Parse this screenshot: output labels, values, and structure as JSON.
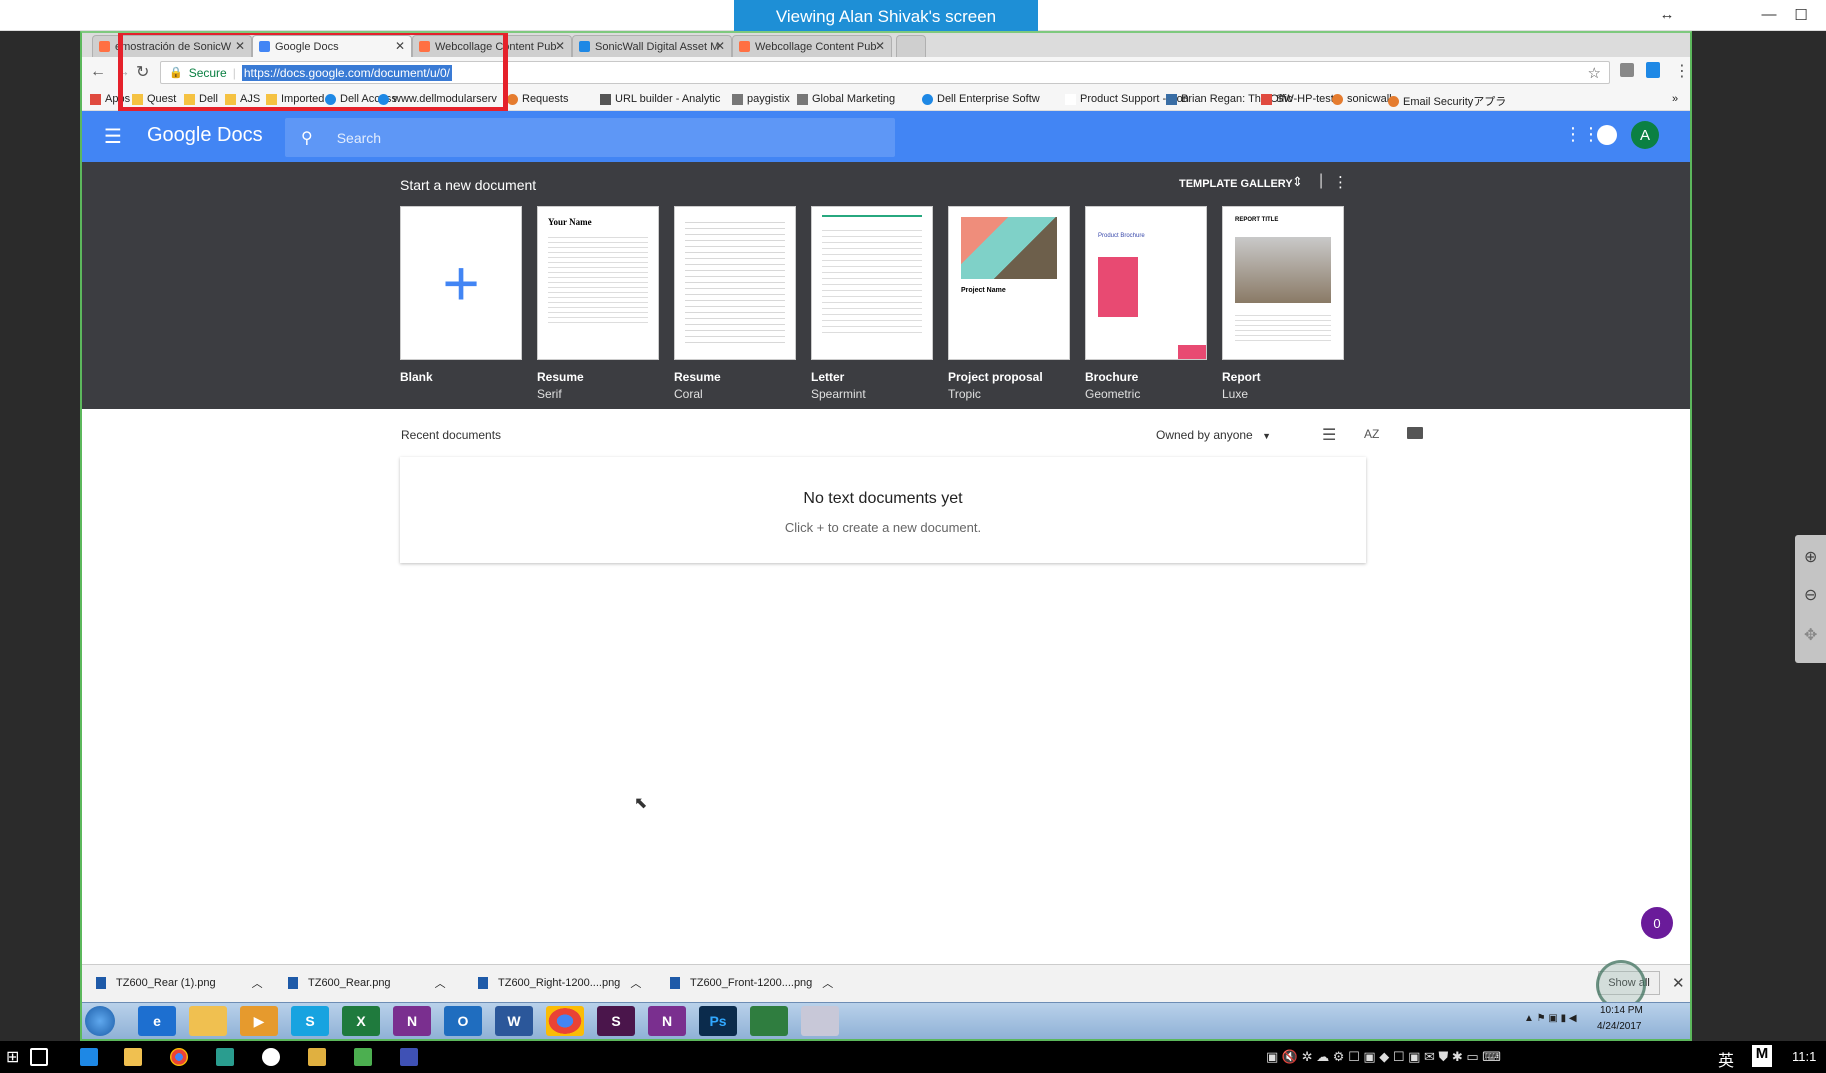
{
  "viewer": {
    "banner": "Viewing Alan Shivak's screen"
  },
  "browser": {
    "tabs": [
      {
        "label": "emostración de SonicW",
        "color": "#ff7043"
      },
      {
        "label": "Google Docs",
        "color": "#4285f4"
      },
      {
        "label": "Webcollage Content Pub",
        "color": "#ff7043"
      },
      {
        "label": "SonicWall Digital Asset M",
        "color": "#1e88e5"
      },
      {
        "label": "Webcollage Content Pub",
        "color": "#ff7043"
      }
    ],
    "secure_label": "Secure",
    "url": "https://docs.google.com/document/u/0/",
    "bookmarks": [
      {
        "label": "Apps",
        "icon": "apps-grid-icon",
        "color": "#e04a3f"
      },
      {
        "label": "Quest",
        "icon": "folder-icon",
        "color": "#f5c242"
      },
      {
        "label": "Dell",
        "icon": "folder-icon",
        "color": "#f5c242"
      },
      {
        "label": "AJS",
        "icon": "folder-icon",
        "color": "#f5c242"
      },
      {
        "label": "Imported",
        "icon": "folder-icon",
        "color": "#f5c242"
      },
      {
        "label": "Dell Access",
        "icon": "dell-icon",
        "color": "#1e88e5"
      },
      {
        "label": "www.dellmodularserv",
        "icon": "dell-icon",
        "color": "#1e88e5"
      },
      {
        "label": "Requests",
        "icon": "circle-icon",
        "color": "#e57c2f"
      },
      {
        "label": "URL builder - Analytic",
        "icon": "google-icon",
        "color": "#555"
      },
      {
        "label": "paygistix",
        "icon": "page-icon",
        "color": "#777"
      },
      {
        "label": "Global Marketing",
        "icon": "page-icon",
        "color": "#777"
      },
      {
        "label": "Dell Enterprise Softw",
        "icon": "dell-icon",
        "color": "#1e88e5"
      },
      {
        "label": "Product Support - Son",
        "icon": "blank-icon",
        "color": "#fff"
      },
      {
        "label": "Brian Regan: The Offic",
        "icon": "person-icon",
        "color": "#3a6ea5"
      },
      {
        "label": "SW-HP-test",
        "icon": "sonicwall-icon",
        "color": "#e04a3f"
      },
      {
        "label": "sonicwall",
        "icon": "circle-icon",
        "color": "#e57c2f"
      },
      {
        "label": "Email Securityアプラ",
        "icon": "circle-icon",
        "color": "#e57c2f"
      }
    ]
  },
  "gdocs": {
    "logo": "Google Docs",
    "search_placeholder": "Search",
    "avatar_letter": "A",
    "start_new": "Start a new document",
    "template_gallery": "TEMPLATE GALLERY",
    "templates": [
      {
        "name": "Blank",
        "sub": ""
      },
      {
        "name": "Resume",
        "sub": "Serif",
        "header": "Your Name"
      },
      {
        "name": "Resume",
        "sub": "Coral"
      },
      {
        "name": "Letter",
        "sub": "Spearmint"
      },
      {
        "name": "Project proposal",
        "sub": "Tropic",
        "header": "Project Name"
      },
      {
        "name": "Brochure",
        "sub": "Geometric",
        "header": "Product Brochure"
      },
      {
        "name": "Report",
        "sub": "Luxe",
        "header": "REPORT TITLE"
      }
    ],
    "recent_label": "Recent documents",
    "owned_by": "Owned by anyone",
    "empty_title": "No text documents yet",
    "empty_sub": "Click + to create a new document.",
    "badge_count": "0"
  },
  "downloads": {
    "items": [
      "TZ600_Rear (1).png",
      "TZ600_Rear.png",
      "TZ600_Right-1200....png",
      "TZ600_Front-1200....png"
    ],
    "show_all": "Show all"
  },
  "remote_taskbar": {
    "time": "10:14 PM",
    "date": "4/24/2017"
  },
  "local_taskbar": {
    "ime": "英",
    "time": "11:1"
  }
}
